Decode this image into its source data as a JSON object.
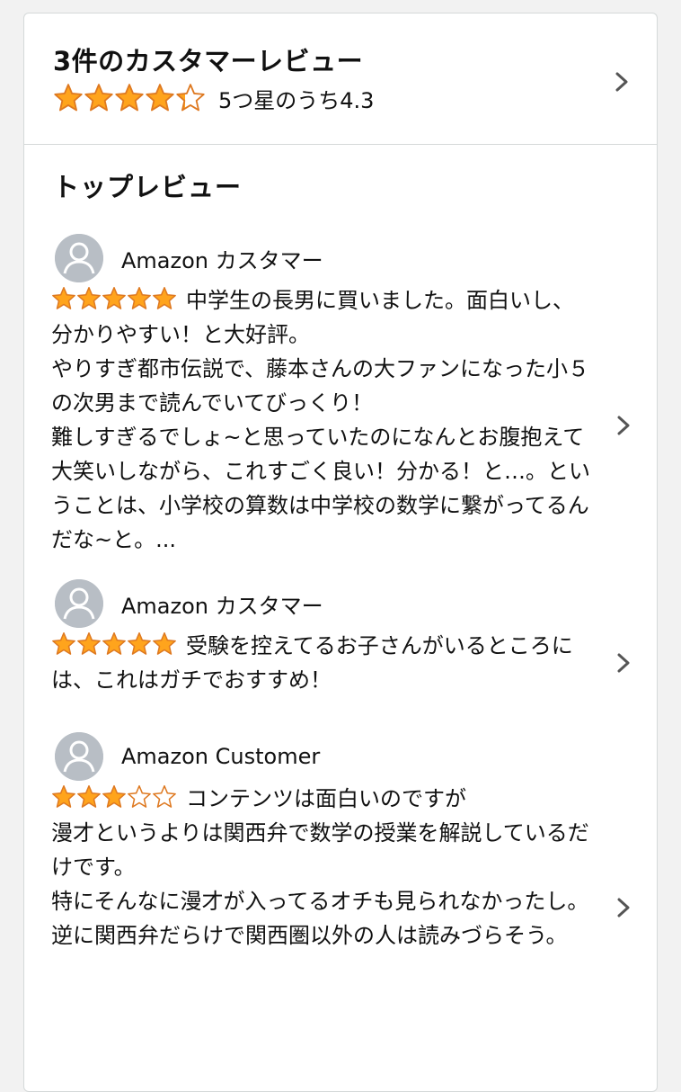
{
  "summary": {
    "title": "3件のカスタマーレビュー",
    "rating": 4.3,
    "rating_text": "5つ星のうち4.3"
  },
  "top_reviews": {
    "heading": "トップレビュー",
    "items": [
      {
        "author": "Amazon カスタマー",
        "rating": 5,
        "text": "中学生の長男に買いました。面白いし、分かりやすい！と大好評。\nやりすぎ都市伝説で、藤本さんの大ファンになった小５の次男まで読んでいてびっくり！\n難しすぎるでしょ~と思っていたのになんとお腹抱えて大笑いしながら、これすごく良い！分かる！と…。ということは、小学校の算数は中学校の数学に繋がってるんだな~と。..."
      },
      {
        "author": "Amazon カスタマー",
        "rating": 5,
        "text": "受験を控えてるお子さんがいるところには、これはガチでおすすめ！"
      },
      {
        "author": "Amazon Customer",
        "rating": 3,
        "text": "コンテンツは面白いのですが\n漫才というよりは関西弁で数学の授業を解説しているだけです。\n特にそんなに漫才が入ってるオチも見られなかったし。\n逆に関西弁だらけで関西圏以外の人は読みづらそう。"
      }
    ]
  },
  "colors": {
    "star_fill": "#ffa41c",
    "star_stroke": "#de7921",
    "star_empty": "#ffffff",
    "border": "#d5d9d9",
    "avatar_bg": "#b8bec5",
    "chevron": "#555555"
  },
  "icons": {
    "chevron": "chevron-right-icon",
    "avatar": "user-avatar-icon",
    "star": "star-icon"
  }
}
